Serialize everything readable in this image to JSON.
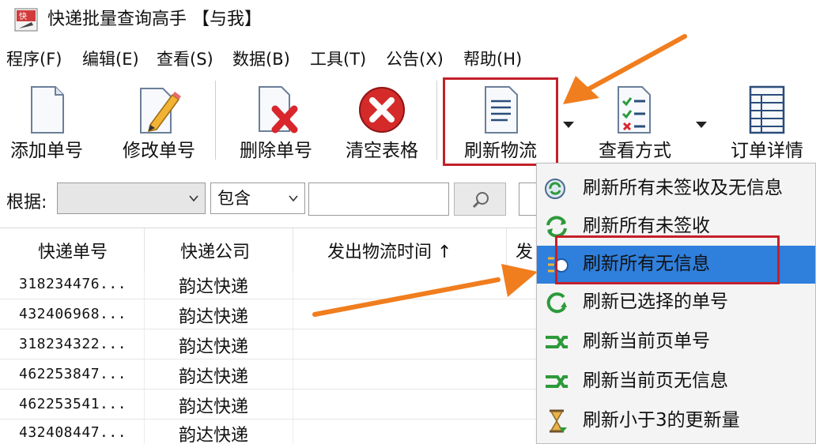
{
  "window": {
    "title": "快递批量查询高手 【与我】"
  },
  "menu": [
    "程序(F)",
    "编辑(E)",
    "查看(S)",
    "数据(B)",
    "工具(T)",
    "公告(X)",
    "帮助(H)"
  ],
  "toolbar": {
    "add": "添加单号",
    "edit": "修改单号",
    "delete": "删除单号",
    "clear": "清空表格",
    "refresh": "刷新物流",
    "view_mode": "查看方式",
    "order_detail": "订单详情"
  },
  "filter": {
    "label": "根据:",
    "field_value": "",
    "match_value": "包含",
    "search_text": ""
  },
  "table": {
    "columns": [
      "快递单号",
      "快递公司",
      "发出物流时间 ↑",
      "发"
    ],
    "rows": [
      {
        "no": "318234476...",
        "company": "韵达快递"
      },
      {
        "no": "432406968...",
        "company": "韵达快递"
      },
      {
        "no": "318234322...",
        "company": "韵达快递"
      },
      {
        "no": "462253847...",
        "company": "韵达快递"
      },
      {
        "no": "462253541...",
        "company": "韵达快递"
      },
      {
        "no": "432408447...",
        "company": "韵达快递"
      }
    ]
  },
  "refresh_menu": {
    "items": [
      {
        "label": "刷新所有未签收及无信息",
        "icon": "refresh-globe-icon"
      },
      {
        "label": "刷新所有未签收",
        "icon": "refresh-cycle-icon"
      },
      {
        "label": "刷新所有无信息",
        "icon": "refresh-info-icon",
        "selected": true
      },
      {
        "label": "刷新已选择的单号",
        "icon": "refresh-selected-icon"
      },
      {
        "label": "刷新当前页单号",
        "icon": "refresh-page-icon"
      },
      {
        "label": "刷新当前页无信息",
        "icon": "refresh-page-info-icon"
      },
      {
        "label": "刷新小于3的更新量",
        "icon": "hourglass-icon"
      }
    ]
  },
  "colors": {
    "highlight_box": "#c4202a",
    "selection": "#2f7fdc",
    "annotation_arrow": "#f07d1e"
  }
}
